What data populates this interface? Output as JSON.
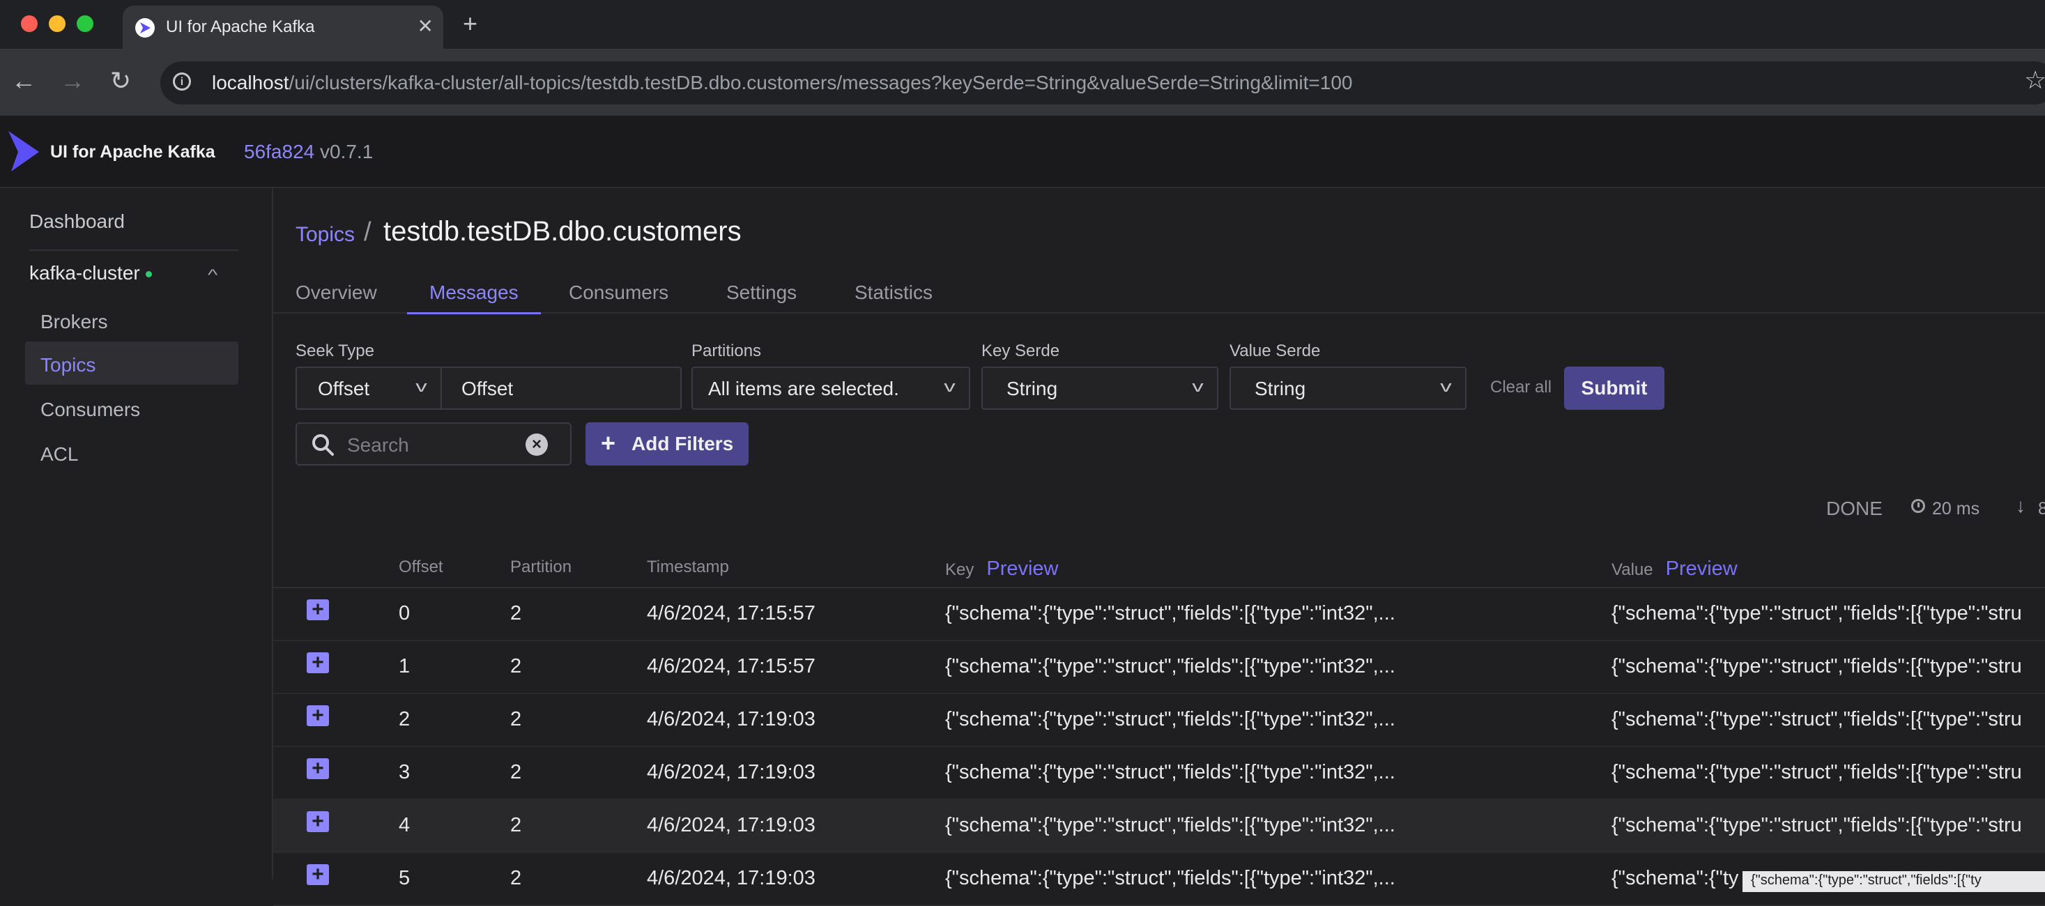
{
  "browser": {
    "tab_title": "UI for Apache Kafka",
    "url_host": "localhost",
    "url_path": "/ui/clusters/kafka-cluster/all-topics/testdb.testDB.dbo.customers/messages?keySerde=String&valueSerde=String&limit=100"
  },
  "header": {
    "app_name": "UI for Apache Kafka",
    "commit": "56fa824",
    "version": "v0.7.1"
  },
  "sidebar": {
    "dashboard": "Dashboard",
    "cluster": "kafka-cluster",
    "items": [
      "Brokers",
      "Topics",
      "Consumers",
      "ACL"
    ]
  },
  "breadcrumb": {
    "link": "Topics",
    "separator": "/",
    "title": "testdb.testDB.dbo.customers"
  },
  "tabs": [
    "Overview",
    "Messages",
    "Consumers",
    "Settings",
    "Statistics"
  ],
  "filters": {
    "seek_type_label": "Seek Type",
    "seek_type_value": "Offset",
    "offset_value": "Offset",
    "partitions_label": "Partitions",
    "partitions_value": "All items are selected.",
    "key_serde_label": "Key Serde",
    "key_serde_value": "String",
    "value_serde_label": "Value Serde",
    "value_serde_value": "String",
    "clear_all": "Clear all",
    "submit": "Submit",
    "search_placeholder": "Search",
    "add_filters": "Add Filters"
  },
  "status": {
    "state": "DONE",
    "elapsed": "20 ms",
    "count": "8"
  },
  "table": {
    "headers": {
      "offset": "Offset",
      "partition": "Partition",
      "timestamp": "Timestamp",
      "key": "Key",
      "value": "Value",
      "preview": "Preview"
    },
    "rows": [
      {
        "offset": "0",
        "partition": "2",
        "timestamp": "4/6/2024, 17:15:57",
        "key": "{\"schema\":{\"type\":\"struct\",\"fields\":[{\"type\":\"int32\",...",
        "value": "{\"schema\":{\"type\":\"struct\",\"fields\":[{\"type\":\"stru"
      },
      {
        "offset": "1",
        "partition": "2",
        "timestamp": "4/6/2024, 17:15:57",
        "key": "{\"schema\":{\"type\":\"struct\",\"fields\":[{\"type\":\"int32\",...",
        "value": "{\"schema\":{\"type\":\"struct\",\"fields\":[{\"type\":\"stru"
      },
      {
        "offset": "2",
        "partition": "2",
        "timestamp": "4/6/2024, 17:19:03",
        "key": "{\"schema\":{\"type\":\"struct\",\"fields\":[{\"type\":\"int32\",...",
        "value": "{\"schema\":{\"type\":\"struct\",\"fields\":[{\"type\":\"stru"
      },
      {
        "offset": "3",
        "partition": "2",
        "timestamp": "4/6/2024, 17:19:03",
        "key": "{\"schema\":{\"type\":\"struct\",\"fields\":[{\"type\":\"int32\",...",
        "value": "{\"schema\":{\"type\":\"struct\",\"fields\":[{\"type\":\"stru"
      },
      {
        "offset": "4",
        "partition": "2",
        "timestamp": "4/6/2024, 17:19:03",
        "key": "{\"schema\":{\"type\":\"struct\",\"fields\":[{\"type\":\"int32\",...",
        "value": "{\"schema\":{\"type\":\"struct\",\"fields\":[{\"type\":\"stru"
      },
      {
        "offset": "5",
        "partition": "2",
        "timestamp": "4/6/2024, 17:19:03",
        "key": "{\"schema\":{\"type\":\"struct\",\"fields\":[{\"type\":\"int32\",...",
        "value": "{\"schema\":{\"ty"
      }
    ],
    "tooltip": "{\"schema\":{\"type\":\"struct\",\"fields\":[{\"ty"
  },
  "colors": {
    "accent": "#8e86ff",
    "button": "#4a458c",
    "background": "#1f1f21",
    "status_dot": "#2ecc71"
  }
}
